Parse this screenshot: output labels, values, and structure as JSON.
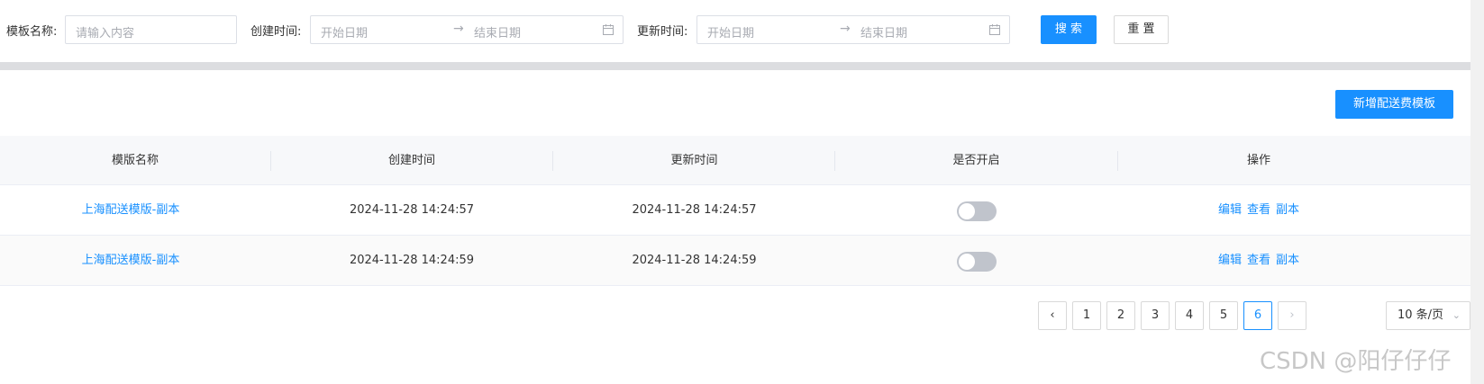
{
  "filters": {
    "template_name_label": "模板名称:",
    "template_name_placeholder": "请输入内容",
    "create_time_label": "创建时间:",
    "create_start_placeholder": "开始日期",
    "create_end_placeholder": "结束日期",
    "update_time_label": "更新时间:",
    "update_start_placeholder": "开始日期",
    "update_end_placeholder": "结束日期",
    "range_separator": "→",
    "search_label": "搜 索",
    "reset_label": "重 置"
  },
  "toolbar": {
    "add_label": "新增配送费模板"
  },
  "table": {
    "columns": [
      "模版名称",
      "创建时间",
      "更新时间",
      "是否开启",
      "操作"
    ],
    "rows": [
      {
        "name": "上海配送模版-副本",
        "created": "2024-11-28 14:24:57",
        "updated": "2024-11-28 14:24:57",
        "enabled": false,
        "actions": [
          "编辑",
          "查看",
          "副本"
        ]
      },
      {
        "name": "上海配送模版-副本",
        "created": "2024-11-28 14:24:59",
        "updated": "2024-11-28 14:24:59",
        "enabled": false,
        "actions": [
          "编辑",
          "查看",
          "副本"
        ]
      }
    ]
  },
  "pagination": {
    "prev": "‹",
    "pages": [
      "1",
      "2",
      "3",
      "4",
      "5",
      "6"
    ],
    "current": "6",
    "next": "›",
    "page_size": "10 条/页"
  },
  "watermark": "CSDN @阳仔仔仔",
  "colors": {
    "primary": "#1890ff",
    "divider": "#dcdde0",
    "switch_off": "#c0c4cc"
  }
}
